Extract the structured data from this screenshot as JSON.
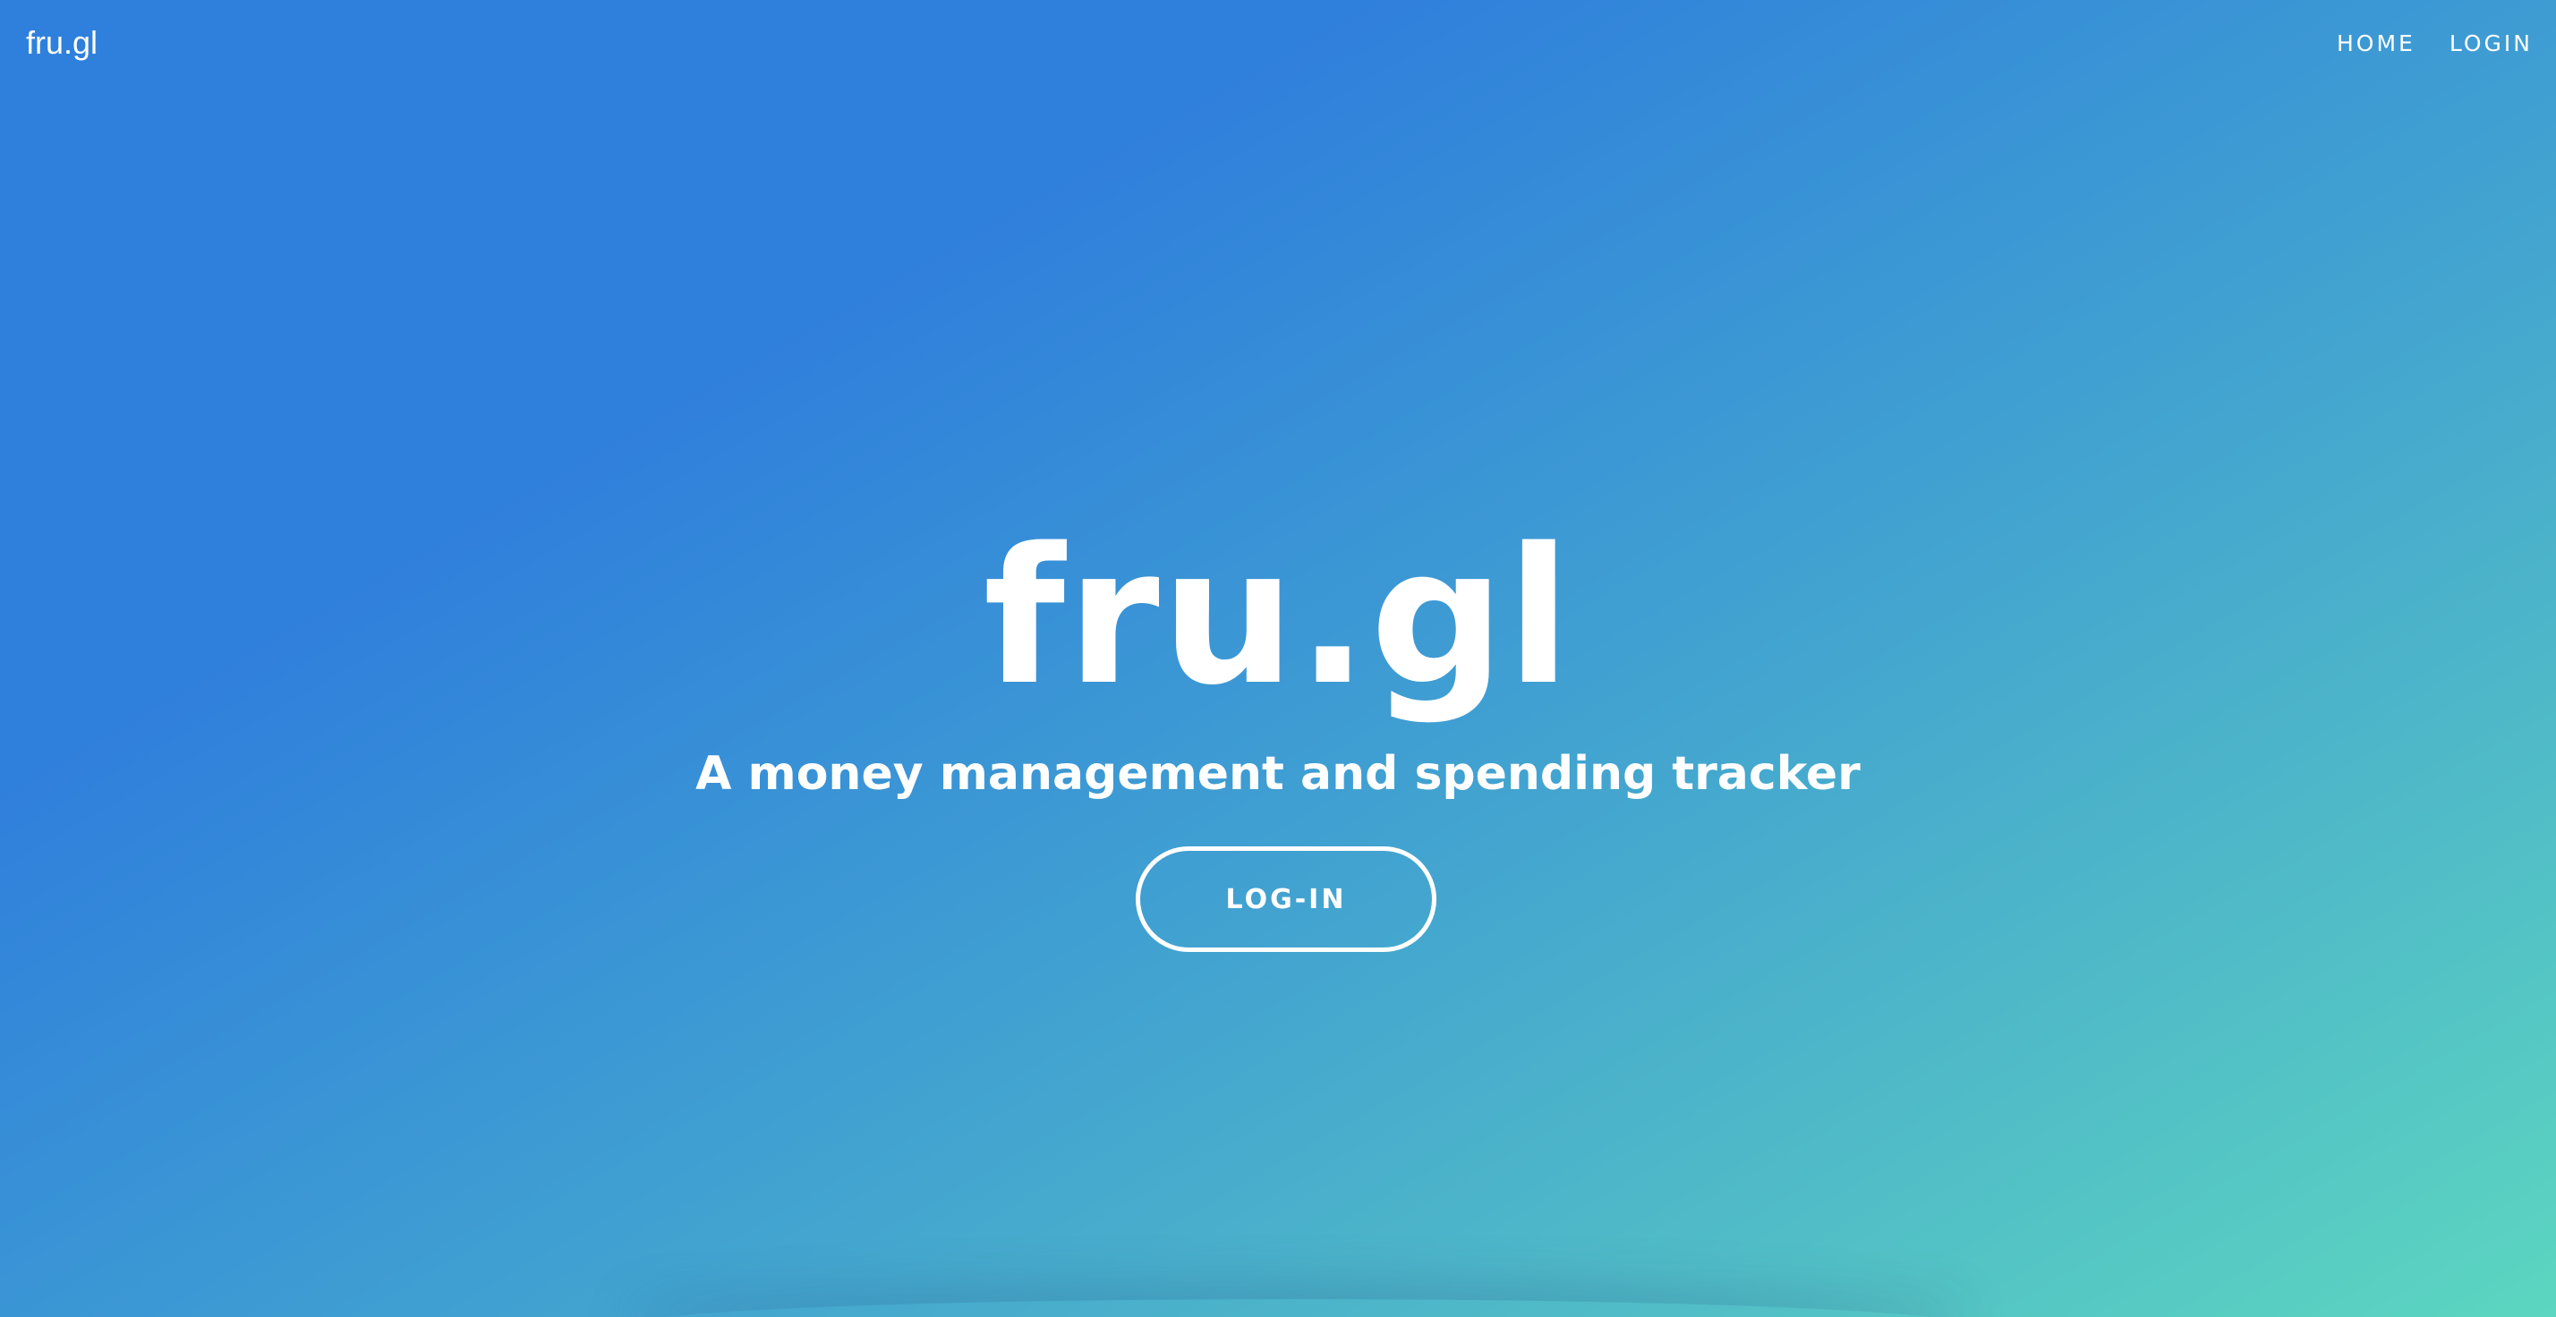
{
  "navbar": {
    "brand": "fru.gl",
    "links": [
      {
        "label": "HOME"
      },
      {
        "label": "LOGIN"
      }
    ]
  },
  "hero": {
    "title": "fru.gl",
    "subtitle": "A money management and spending tracker",
    "cta_label": "LOG-IN"
  },
  "colors": {
    "gradient_start": "#2f80dc",
    "gradient_end": "#5cd6c0",
    "text": "#ffffff"
  }
}
